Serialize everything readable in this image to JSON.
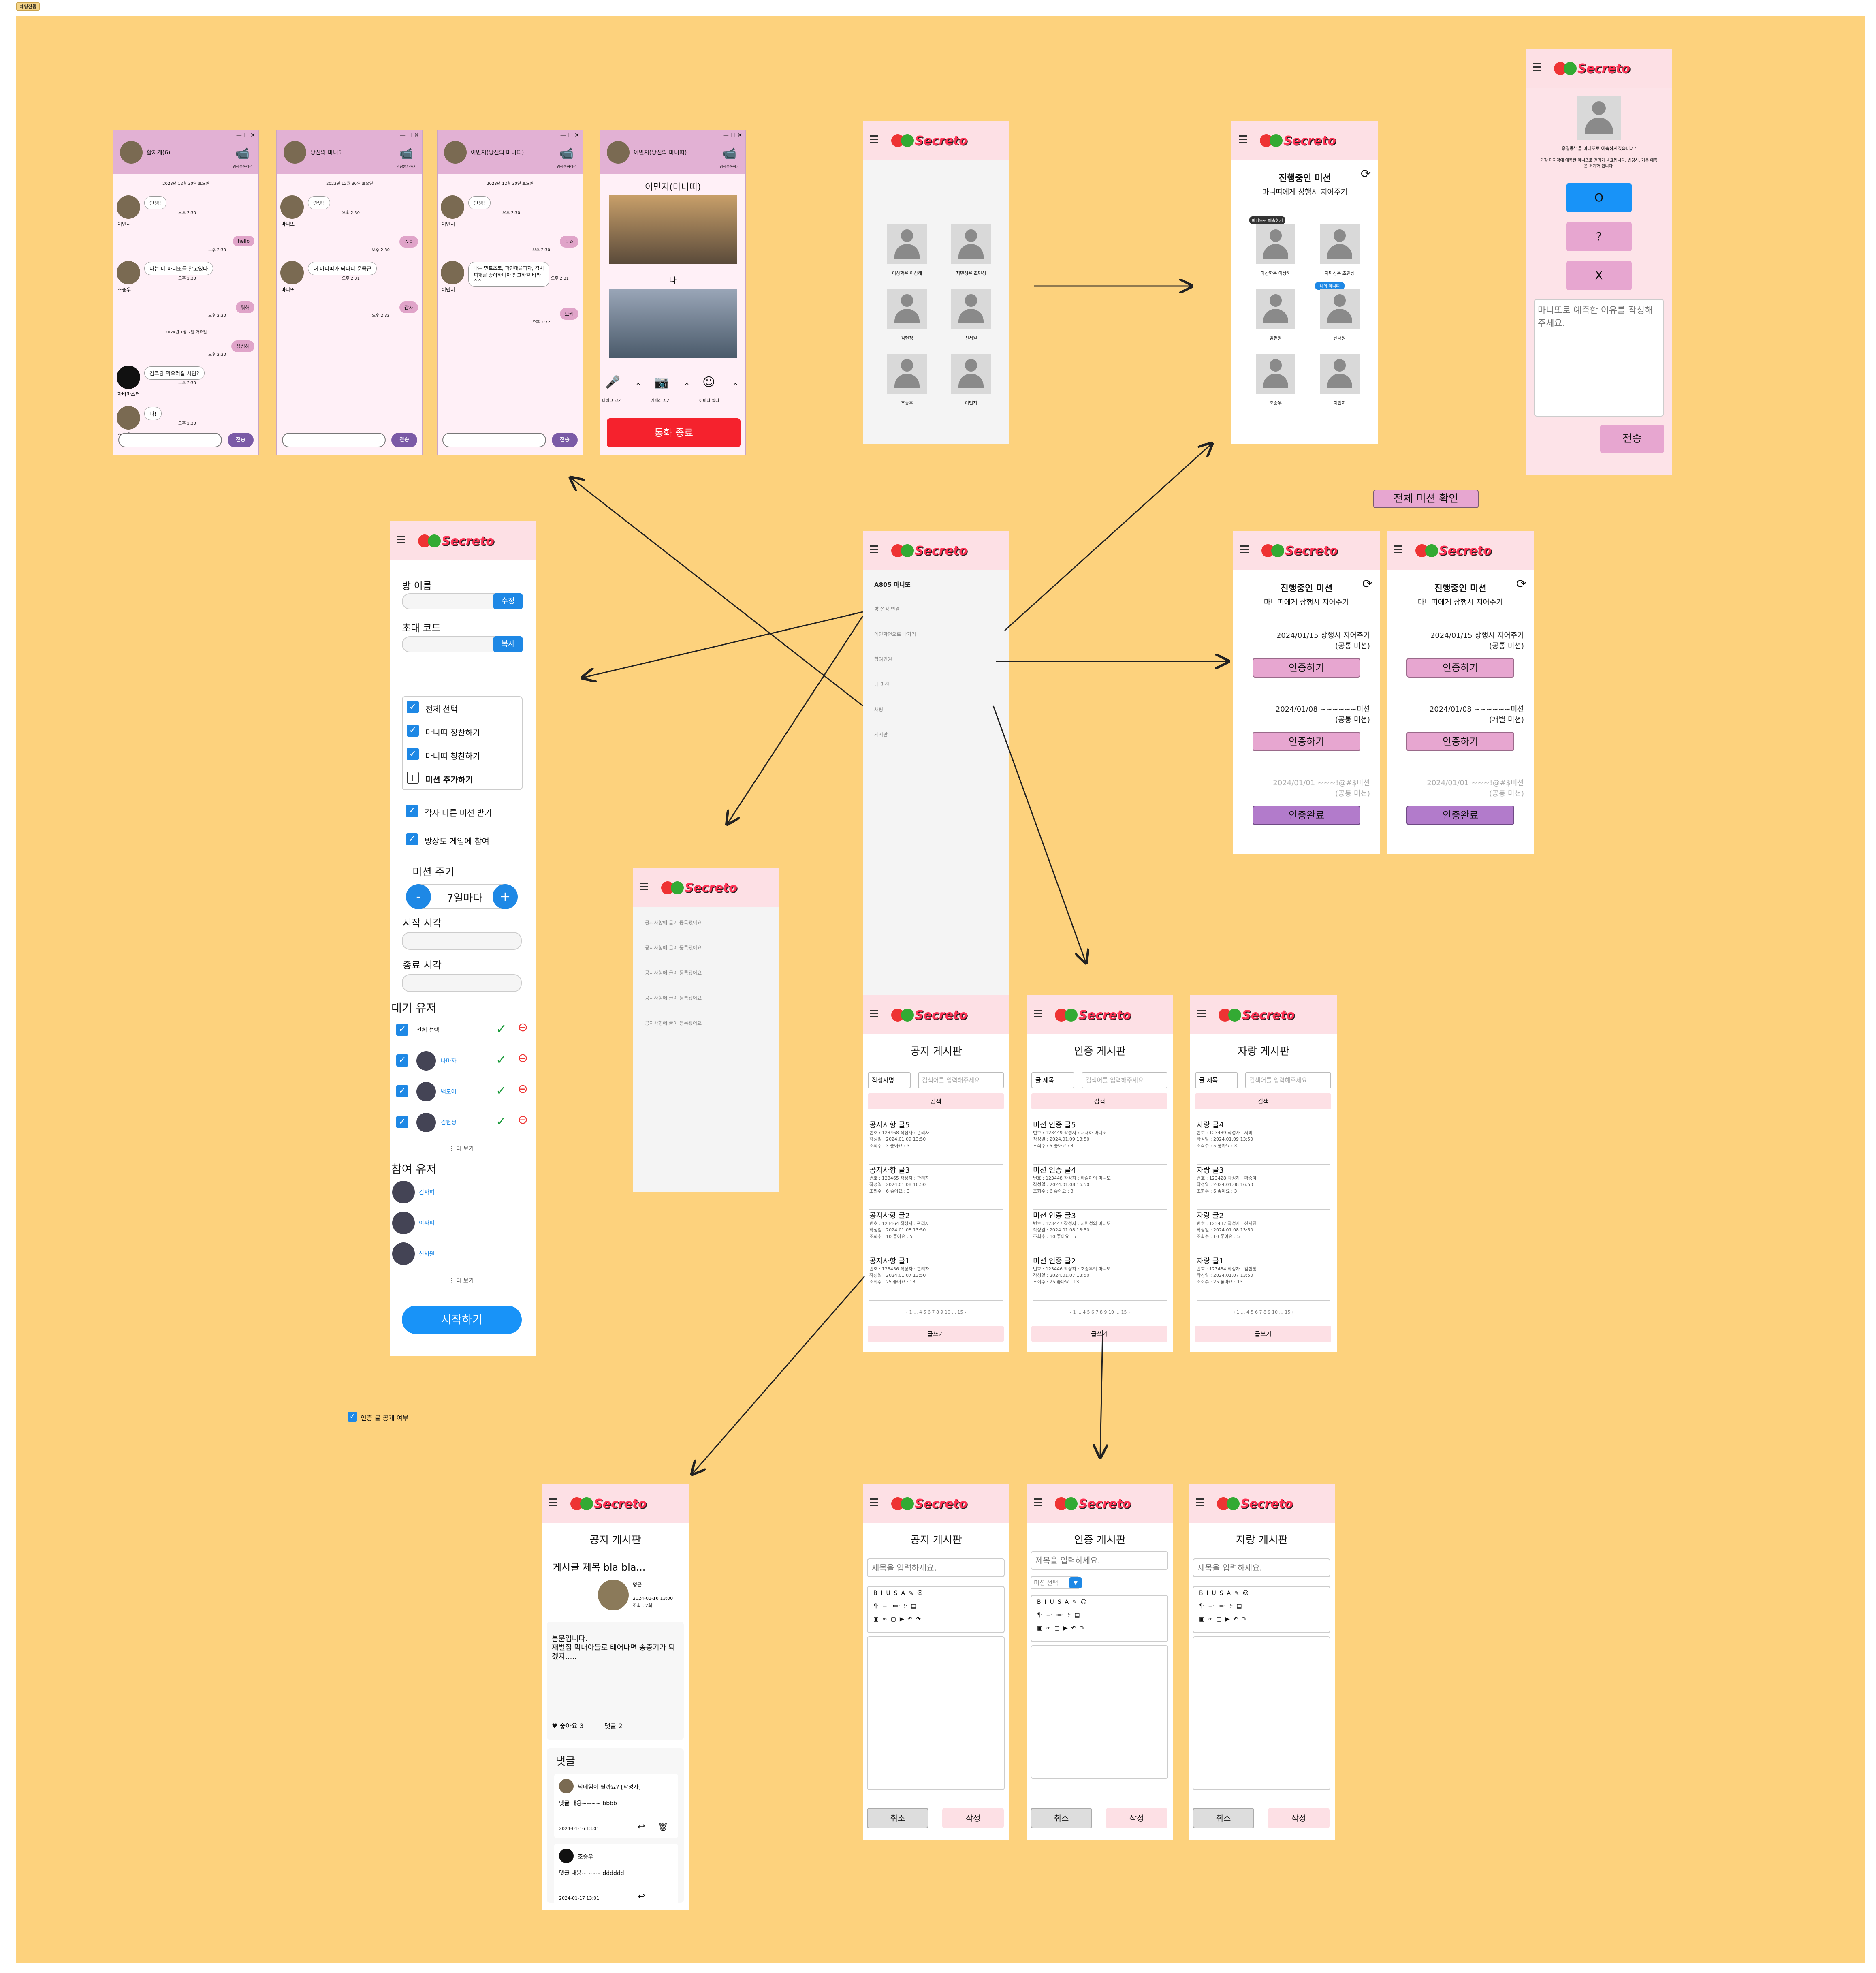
{
  "page_tag": "채팅진행",
  "logo_text": "Secreto",
  "chat_windows": [
    {
      "title": "활자개(6)",
      "date1": "2023년 12월 30일 토요일",
      "date2": "2024년 1월 2일 화요일",
      "msgs": [
        {
          "text": "안녕!",
          "name": "이민지",
          "time": "오후 2:30"
        },
        {
          "mine": "hello",
          "time": "오후 2:30"
        },
        {
          "text": "나는 네 마니또를 알고있다",
          "name": "조승우",
          "time": "오후 2:30"
        },
        {
          "mine": "뭐해",
          "time": "오후 2:30"
        },
        {
          "mine": "심심해",
          "time": "오후 2:30"
        },
        {
          "text": "김크랑 먹으러갈 사람?",
          "name": "자바마스터",
          "time": "오후 2:30"
        },
        {
          "text": "나!",
          "name": "조승우",
          "time": "오후 2:30"
        }
      ],
      "send": "전송",
      "call_label": "영상통화하기"
    },
    {
      "title": "당신의 마니또",
      "date1": "2023년 12월 30일 토요일",
      "msgs": [
        {
          "text": "안녕!",
          "name": "마니또",
          "time": "오후 2:30"
        },
        {
          "mine": "ㅎㅇ",
          "time": "오후 2:30"
        },
        {
          "text": "내 마니띠가 되다니 운좋군",
          "name": "마니또",
          "time": "오후 2:31"
        },
        {
          "mine": "감사",
          "time": "오후 2:32"
        }
      ],
      "send": "전송",
      "call_label": "영상통화하기"
    },
    {
      "title": "이민지(당신의 마니띠)",
      "date1": "2023년 12월 30일 토요일",
      "msgs": [
        {
          "text": "안녕!",
          "name": "이민지",
          "time": "오후 2:30"
        },
        {
          "mine": "ㅎㅇ",
          "time": "오후 2:30"
        },
        {
          "text": "나는 민트초코, 파인애플피자, 김치찌개를 좋아하니까 참고하길 바라^^",
          "name": "이민지",
          "time": "오후 2:31"
        },
        {
          "mine": "오케",
          "time": "오후 2:32"
        }
      ],
      "send": "전송",
      "call_label": "영상통화하기"
    },
    {
      "title": "이민지(당신의 마니띠)",
      "callee": "이민지(마니띠)",
      "me": "나",
      "controls": [
        "마이크 끄기",
        "카메라 끄기",
        "아바타 필터"
      ],
      "end_call": "통화 종료",
      "call_label": "영상통화하기"
    }
  ],
  "members_screen": {
    "members": [
      "이상학은 이상해",
      "지민성은 조민성",
      "김현정",
      "신서원",
      "조승우",
      "이민지"
    ]
  },
  "progress_screen": {
    "title": "진행중인 미션",
    "subtitle": "마니띠에게 상행시 지어주기",
    "badge1": "마니또로 예측하기",
    "badge2": "나의 마니띠",
    "members": [
      "이상학은 이상해",
      "지민성은 조민성",
      "김현정",
      "신서원",
      "조승우",
      "이민지"
    ]
  },
  "predict_screen": {
    "intro": "흥길동님을 마니또로 예측하시겠습니까?",
    "intro_sub": "가장 마지막에 예측한 마니또로 결과가 발표됩니다. 변경시, 기존 예측은 초기화 됩니다.",
    "o": "O",
    "q": "?",
    "x": "X",
    "placeholder": "마니또로 예측한 이유를 작성해주세요.",
    "send": "전송"
  },
  "all_missions_label": "전체 미션 확인",
  "settings_screen": {
    "room_name_label": "방 이름",
    "edit": "수정",
    "invite_label": "초대 코드",
    "copy": "복사",
    "missions": [
      "전체 선택",
      "마니띠 칭찬하기",
      "마니띠 칭찬하기",
      "미션 추가하기"
    ],
    "opt1": "각자 다른 미션 받기",
    "opt2": "방장도 게임에 참여",
    "cycle_label": "미션 주기",
    "cycle_value": "7일마다",
    "minus": "-",
    "plus": "+",
    "start_label": "시작 시각",
    "end_label": "종료 시각",
    "waiting_label": "대기 유저",
    "waiting": [
      "전체 선택",
      "나마자",
      "백도어",
      "김현정"
    ],
    "more1": "⋮ 더 보기",
    "joined_label": "참여 유저",
    "joined": [
      "김싸피",
      "이싸피",
      "신서원"
    ],
    "more2": "⋮ 더 보기",
    "start_btn": "시작하기"
  },
  "cert_public": "인증 글 공개 여부",
  "menu_screen": {
    "items": [
      "A805 마니또",
      "방 설정 변경",
      "메인화면으로 나가기",
      "참여인원",
      "내 미션",
      "채팅",
      "게시판"
    ]
  },
  "notice_list_screen": {
    "rows": [
      "공지사항에 글이 등록됐어요",
      "공지사항에 글이 등록됐어요",
      "공지사항에 글이 등록됐어요",
      "공지사항에 글이 등록됐어요",
      "공지사항에 글이 등록됐어요"
    ]
  },
  "mission_screens": [
    {
      "title": "진행중인 미션",
      "subtitle": "마니띠에게 삼행시 지어주기",
      "missions": [
        {
          "line": "2024/01/15 상행시 지어주기",
          "kind": "(공통 미션)",
          "btn": "인증하기",
          "done": false
        },
        {
          "line": "2024/01/08 ~~~~~~미션",
          "kind": "(공통 미션)",
          "btn": "인증하기",
          "done": false
        },
        {
          "line": "2024/01/01 ~~~!@#$미션",
          "kind": "(공통 미션)",
          "btn": "인증완료",
          "done": true
        }
      ]
    },
    {
      "title": "진행중인 미션",
      "subtitle": "마니띠에게 삼행시 지어주기",
      "missions": [
        {
          "line": "2024/01/15 상행시 지어주기",
          "kind": "(공통 미션)",
          "btn": "인증하기",
          "done": false
        },
        {
          "line": "2024/01/08 ~~~~~~미션",
          "kind": "(개별 미션)",
          "btn": "인증하기",
          "done": false
        },
        {
          "line": "2024/01/01 ~~~!@#$미션",
          "kind": "(공통 미션)",
          "btn": "인증완료",
          "done": true
        }
      ]
    }
  ],
  "boards": [
    {
      "title": "공지 게시판",
      "filter": "작성자명",
      "placeholder": "검색어를 입력해주세요.",
      "search": "검색",
      "rows": [
        {
          "t": "공지사항 글5",
          "m1": "번호 : 123468",
          "w": "작성자 : 관리자",
          "d": "작성일 : 2024.01.09 13:50",
          "v": "조회수 : 3   좋아요 : 3"
        },
        {
          "t": "공지사항 글3",
          "m1": "번호 : 123465",
          "w": "작성자 : 관리자",
          "d": "작성일 : 2024.01.08 16:50",
          "v": "조회수 : 6   좋아요 : 3"
        },
        {
          "t": "공지사항 글2",
          "m1": "번호 : 123464",
          "w": "작성자 : 관리자",
          "d": "작성일 : 2024.01.08 13:50",
          "v": "조회수 : 10   좋아요 : 5"
        },
        {
          "t": "공지사항 글1",
          "m1": "번호 : 123456",
          "w": "작성자 : 관리자",
          "d": "작성일 : 2024.01.07 13:50",
          "v": "조회수 : 25   좋아요 : 13"
        }
      ],
      "pager": "‹  1  ...  4  5  6  7  8  9  10  ...  15  ›",
      "write": "글쓰기"
    },
    {
      "title": "인증 게시판",
      "filter": "글 제목",
      "placeholder": "검색어를 입력해주세요.",
      "search": "검색",
      "rows": [
        {
          "t": "미션 인증 글5",
          "m1": "번호 : 123449",
          "w": "작성자 : 서재하 마니또",
          "d": "작성일 : 2024.01.09 13:50",
          "v": "조회수 : 5   좋아요 : 3"
        },
        {
          "t": "미션 인증 글4",
          "m1": "번호 : 123448",
          "w": "작성자 : 확슬아의 마니또",
          "d": "작성일 : 2024.01.08 16:50",
          "v": "조회수 : 6   좋아요 : 3"
        },
        {
          "t": "미션 인증 글3",
          "m1": "번호 : 123447",
          "w": "작성자 : 지민성의 마니또",
          "d": "작성일 : 2024.01.08 13:50",
          "v": "조회수 : 10   좋아요 : 5"
        },
        {
          "t": "미션 인증 글2",
          "m1": "번호 : 123446",
          "w": "작성자 : 조승우의 마니또",
          "d": "작성일 : 2024.01.07 13:50",
          "v": "조회수 : 25   좋아요 : 13"
        }
      ],
      "pager": "‹  1  ...  4  5  6  7  8  9  10  ...  15  ›",
      "write": "글쓰기"
    },
    {
      "title": "자랑 게시판",
      "filter": "글 제목",
      "placeholder": "검색어를 입력해주세요.",
      "search": "검색",
      "rows": [
        {
          "t": "자랑 글4",
          "m1": "번호 : 123439",
          "w": "작성자 : 서피",
          "d": "작성일 : 2024.01.09 13:50",
          "v": "조회수 : 5   좋아요 : 3"
        },
        {
          "t": "자랑 글3",
          "m1": "번호 : 123428",
          "w": "작성자 : 확승아",
          "d": "작성일 : 2024.01.08 16:50",
          "v": "조회수 : 6   좋아요 : 3"
        },
        {
          "t": "자랑 글2",
          "m1": "번호 : 123437",
          "w": "작성자 : 신서원",
          "d": "작성일 : 2024.01.08 13:50",
          "v": "조회수 : 10   좋아요 : 5"
        },
        {
          "t": "자랑 글1",
          "m1": "번호 : 123434",
          "w": "작성자 : 김현정",
          "d": "작성일 : 2024.01.07 13:50",
          "v": "조회수 : 25   좋아요 : 13"
        }
      ],
      "pager": "‹  1  ...  4  5  6  7  8  9  10  ...  15  ›",
      "write": "글쓰기"
    }
  ],
  "detail_screen": {
    "board": "공지 게시판",
    "post_title": "게시글 제목 bla bla...",
    "author": "명균",
    "date": "2024-01-16 13:00",
    "views": "조회 : 2회",
    "body": "본문입니다.\n재벌집 막내아들로 태어나면 송중기가 되겠지.....",
    "likes": "♥ 좋아요 3",
    "comments_count": "댓글 2",
    "comments_label": "댓글",
    "comments": [
      {
        "name": "닉네임이 필까요? [작성자]",
        "text": "댓글 내용~~~~ bbbb",
        "date": "2024-01-16 13:01"
      },
      {
        "name": "조승우",
        "text": "댓글 내용~~~~ dddddd",
        "date": "2024-01-17 13:01"
      }
    ]
  },
  "write_screens": [
    {
      "title": "공지 게시판",
      "placeholder": "제목을 입력하세요.",
      "cancel": "취소",
      "submit": "작성"
    },
    {
      "title": "인증 게시판",
      "placeholder": "제목을 입력하세요.",
      "mission_select": "미션 선택",
      "cancel": "취소",
      "submit": "작성"
    },
    {
      "title": "자랑 게시판",
      "placeholder": "제목을 입력하세요.",
      "cancel": "취소",
      "submit": "작성"
    }
  ],
  "colors": {
    "canvas": "#FDD27D",
    "header": "#FDE0E5",
    "pink_btn": "#E7A6D0",
    "purple_btn": "#B27BCB",
    "blue": "#1E88E5",
    "end_call": "#F5222D"
  }
}
